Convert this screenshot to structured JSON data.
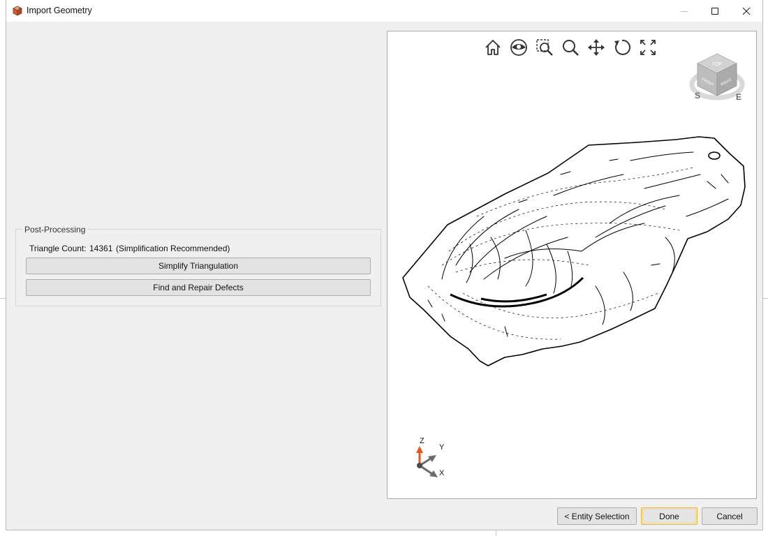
{
  "window": {
    "title": "Import Geometry",
    "icons": {
      "app": "box-app-icon",
      "minimize": "minimize-icon",
      "maximize": "maximize-icon",
      "close": "close-icon"
    }
  },
  "post_processing": {
    "group_label": "Post-Processing",
    "triangle_count_label": "Triangle Count:",
    "triangle_count_value": "14361",
    "recommendation": "(Simplification Recommended)",
    "simplify_button": "Simplify Triangulation",
    "repair_button": "Find and Repair Defects"
  },
  "viewport": {
    "toolbar": [
      {
        "name": "home-icon"
      },
      {
        "name": "look-at-icon"
      },
      {
        "name": "zoom-window-icon"
      },
      {
        "name": "zoom-icon"
      },
      {
        "name": "pan-icon"
      },
      {
        "name": "orbit-icon"
      },
      {
        "name": "fit-all-icon"
      }
    ],
    "viewcube": {
      "faces": {
        "top": "TOP",
        "front": "FRONT",
        "right": "RIGHT"
      },
      "compass": {
        "south": "S",
        "east": "E"
      }
    },
    "triad": {
      "z": "Z",
      "y": "Y",
      "x": "X"
    },
    "colors": {
      "z_axis": "#e8561e",
      "axis": "#6b6b6b"
    }
  },
  "footer": {
    "entity_selection_button": "< Entity Selection",
    "done_button": "Done",
    "cancel_button": "Cancel"
  },
  "colors": {
    "window_bg": "#f0f0f0",
    "button_bg": "#e3e3e3",
    "default_button_border": "#e5b547"
  }
}
